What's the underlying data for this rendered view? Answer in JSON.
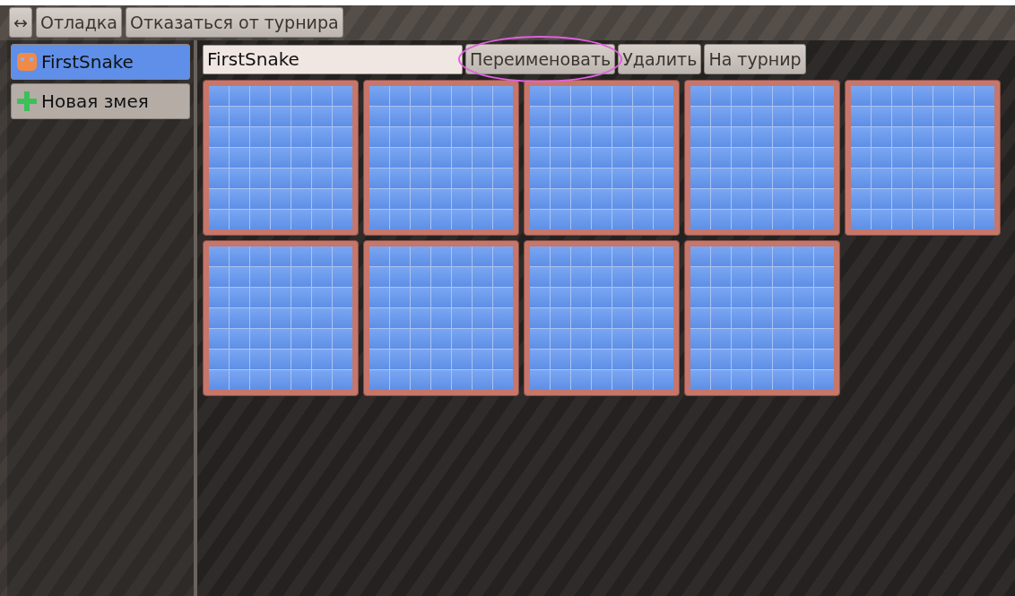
{
  "toolbar": {
    "buttons": [
      {
        "label": "↔"
      },
      {
        "label": "Отладка"
      },
      {
        "label": "Отказаться от турнира"
      }
    ]
  },
  "sidebar": {
    "items": [
      {
        "label": "FirstSnake",
        "kind": "snake",
        "selected": true
      },
      {
        "label": "Новая змея",
        "kind": "add",
        "selected": false
      }
    ]
  },
  "editor": {
    "name_field": {
      "value": "FirstSnake"
    },
    "buttons": [
      {
        "label": "Переименовать",
        "circled": true
      },
      {
        "label": "Удалить",
        "circled": false
      },
      {
        "label": "На турнир",
        "circled": false
      }
    ],
    "tiles": [
      {
        "kind": "grid"
      },
      {
        "kind": "grid"
      },
      {
        "kind": "grid"
      },
      {
        "kind": "grid"
      },
      {
        "kind": "grid"
      },
      {
        "kind": "grid"
      },
      {
        "kind": "grid"
      },
      {
        "kind": "grid"
      },
      {
        "kind": "grid"
      }
    ]
  }
}
